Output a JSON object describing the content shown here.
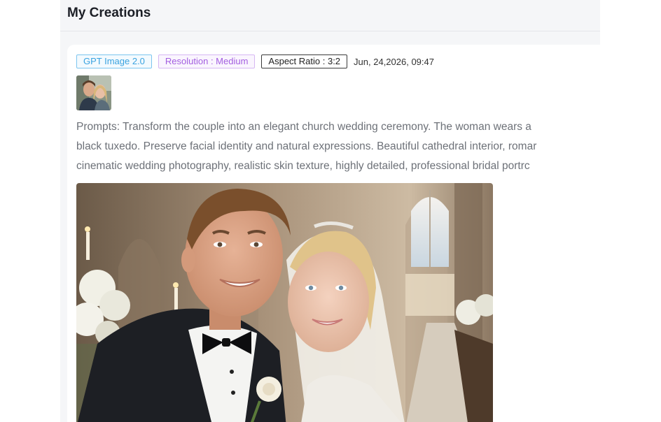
{
  "header": {
    "title": "My Creations"
  },
  "creation": {
    "tags": {
      "model": "GPT Image 2.0",
      "resolution": "Resolution : Medium",
      "aspect_ratio": "Aspect Ratio : 3:2"
    },
    "date": "Jun, 24,2026, 09:47",
    "prompt_lines": [
      "Prompts: Transform the couple into an elegant church wedding ceremony. The woman wears a",
      "black tuxedo. Preserve facial identity and natural expressions. Beautiful cathedral interior, romar",
      "cinematic wedding photography, realistic skin texture, highly detailed, professional bridal portrc"
    ]
  },
  "colors": {
    "model_tag": "#3aa3e0",
    "resolution_tag": "#a35ee0",
    "text_muted": "#6d7178"
  }
}
